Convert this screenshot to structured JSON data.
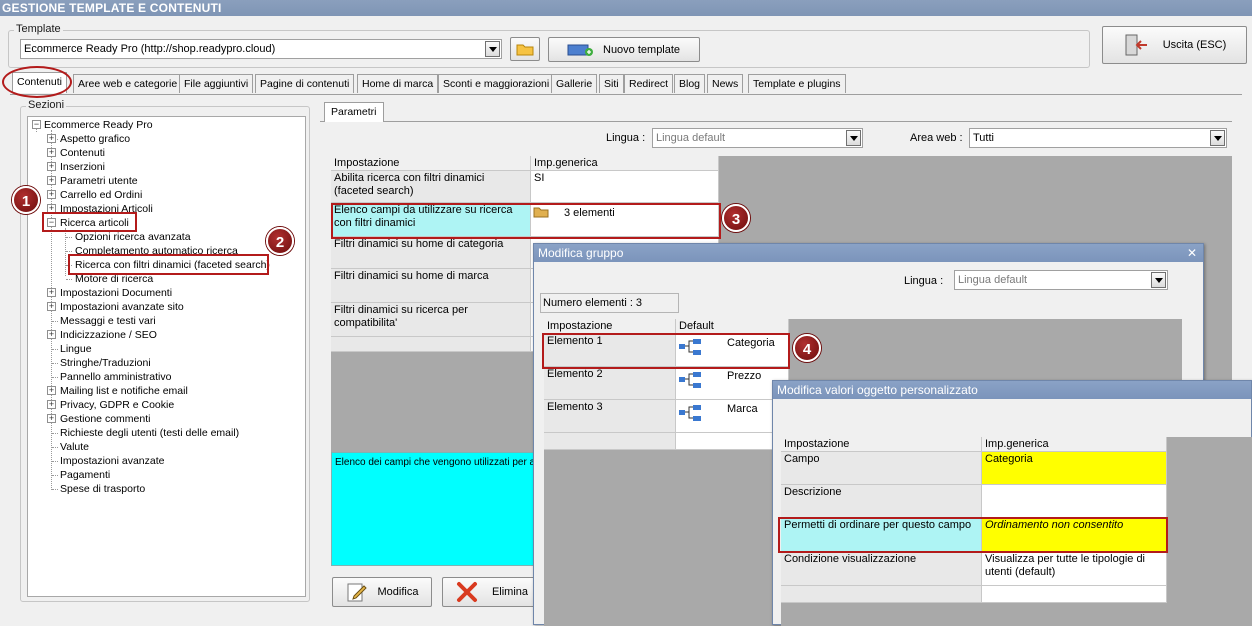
{
  "window": {
    "title": "GESTIONE TEMPLATE E CONTENUTI"
  },
  "template_group": {
    "label": "Template",
    "selected": "Ecommerce Ready Pro (http://shop.readypro.cloud)",
    "new_template_label": "Nuovo template"
  },
  "exit_button": {
    "label": "Uscita (ESC)"
  },
  "tabs": [
    {
      "label": "Contenuti"
    },
    {
      "label": "Aree web e categorie"
    },
    {
      "label": "File aggiuntivi"
    },
    {
      "label": "Pagine di contenuti"
    },
    {
      "label": "Home di marca"
    },
    {
      "label": "Sconti e maggiorazioni"
    },
    {
      "label": "Gallerie"
    },
    {
      "label": "Siti"
    },
    {
      "label": "Redirect"
    },
    {
      "label": "Blog"
    },
    {
      "label": "News"
    },
    {
      "label": "Template e plugins"
    }
  ],
  "sections": {
    "label": "Sezioni",
    "root": "Ecommerce Ready Pro",
    "items": [
      {
        "label": "Aspetto grafico"
      },
      {
        "label": "Contenuti"
      },
      {
        "label": "Inserzioni"
      },
      {
        "label": "Parametri utente"
      },
      {
        "label": "Carrello ed Ordini"
      },
      {
        "label": "Impostazioni Articoli"
      },
      {
        "label": "Ricerca articoli"
      },
      {
        "label": "Opzioni ricerca avanzata"
      },
      {
        "label": "Completamento automatico ricerca"
      },
      {
        "label": "Ricerca con filtri dinamici (faceted search)"
      },
      {
        "label": "Motore di ricerca"
      },
      {
        "label": "Impostazioni Documenti"
      },
      {
        "label": "Impostazioni avanzate sito"
      },
      {
        "label": "Messaggi e testi vari"
      },
      {
        "label": "Indicizzazione / SEO"
      },
      {
        "label": "Lingue"
      },
      {
        "label": "Stringhe/Traduzioni"
      },
      {
        "label": "Pannello amministrativo"
      },
      {
        "label": "Mailing list e notifiche email"
      },
      {
        "label": "Privacy, GDPR e Cookie"
      },
      {
        "label": "Gestione commenti"
      },
      {
        "label": "Richieste degli utenti (testi delle email)"
      },
      {
        "label": "Valute"
      },
      {
        "label": "Impostazioni avanzate"
      },
      {
        "label": "Pagamenti"
      },
      {
        "label": "Spese di trasporto"
      }
    ]
  },
  "params": {
    "tab_label": "Parametri",
    "lingua_label": "Lingua :",
    "lingua_value": "Lingua default",
    "area_label": "Area web :",
    "area_value": "Tutti",
    "col_setting": "Impostazione",
    "col_value": "Imp.generica",
    "rows": [
      {
        "setting": "Abilita ricerca con filtri dinamici (faceted search)",
        "value": "SI"
      },
      {
        "setting": "Elenco campi da utilizzare su ricerca con filtri dinamici",
        "value": "3 elementi"
      },
      {
        "setting": "Filtri dinamici su home di categoria",
        "value": ""
      },
      {
        "setting": "Filtri dinamici su home di marca",
        "value": ""
      },
      {
        "setting": "Filtri dinamici su ricerca per compatibilita'",
        "value": ""
      }
    ],
    "description": "Elenco dei campi che vengono utilizzati per a",
    "modify_label": "Modifica",
    "delete_label": "Elimina"
  },
  "group_dialog": {
    "title": "Modifica gruppo",
    "lingua_label": "Lingua :",
    "lingua_value": "Lingua default",
    "count": "Numero elementi : 3",
    "col_setting": "Impostazione",
    "col_default": "Default",
    "rows": [
      {
        "setting": "Elemento 1",
        "value": "Categoria"
      },
      {
        "setting": "Elemento 2",
        "value": "Prezzo"
      },
      {
        "setting": "Elemento 3",
        "value": "Marca"
      }
    ]
  },
  "object_dialog": {
    "title": "Modifica valori oggetto personalizzato",
    "col_setting": "Impostazione",
    "col_value": "Imp.generica",
    "rows": [
      {
        "setting": "Campo",
        "value": "Categoria"
      },
      {
        "setting": "Descrizione",
        "value": ""
      },
      {
        "setting": "Permetti di ordinare per questo campo",
        "value": "Ordinamento non consentito"
      },
      {
        "setting": "Condizione visualizzazione",
        "value": "Visualizza per tutte le tipologie di utenti (default)"
      }
    ]
  },
  "badges": [
    "1",
    "2",
    "3",
    "4"
  ],
  "colors": {
    "highlight_cyan": "#aef4f4",
    "yellow": "#ffff00",
    "annotation_red": "#b31b1b"
  }
}
